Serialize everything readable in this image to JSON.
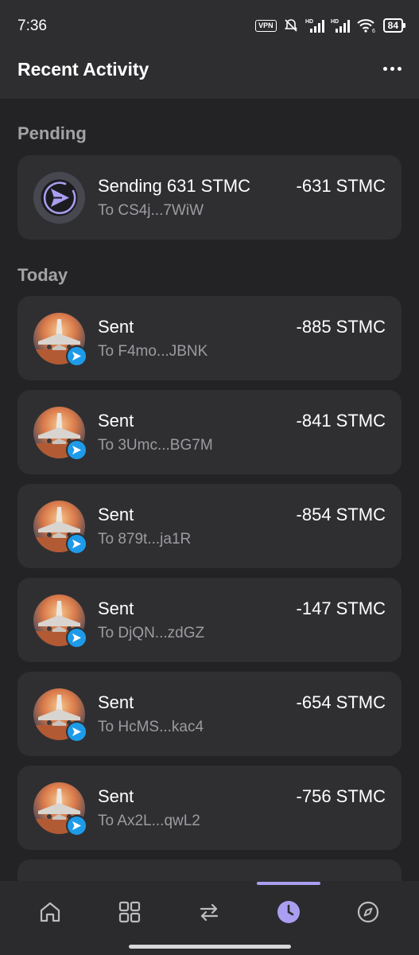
{
  "status": {
    "time": "7:36",
    "vpn": "VPN",
    "hd1": "HD",
    "hd2": "HD",
    "wifi_sub": "6",
    "battery": "84"
  },
  "header": {
    "title": "Recent Activity",
    "more_icon": "more-horizontal-icon"
  },
  "pending": {
    "label": "Pending",
    "items": [
      {
        "title": "Sending 631 STMC",
        "subtitle": "To CS4j...7WiW",
        "amount": "-631 STMC",
        "icon": "send-arrow-icon"
      }
    ]
  },
  "today": {
    "label": "Today",
    "items": [
      {
        "title": "Sent",
        "subtitle": "To F4mo...JBNK",
        "amount": "-885 STMC",
        "icon": "sent-badge-icon"
      },
      {
        "title": "Sent",
        "subtitle": "To 3Umc...BG7M",
        "amount": "-841 STMC",
        "icon": "sent-badge-icon"
      },
      {
        "title": "Sent",
        "subtitle": "To 879t...ja1R",
        "amount": "-854 STMC",
        "icon": "sent-badge-icon"
      },
      {
        "title": "Sent",
        "subtitle": "To DjQN...zdGZ",
        "amount": "-147 STMC",
        "icon": "sent-badge-icon"
      },
      {
        "title": "Sent",
        "subtitle": "To HcMS...kac4",
        "amount": "-654 STMC",
        "icon": "sent-badge-icon"
      },
      {
        "title": "Sent",
        "subtitle": "To Ax2L...qwL2",
        "amount": "-756 STMC",
        "icon": "sent-badge-icon"
      }
    ]
  },
  "nav": {
    "items": [
      {
        "icon": "home-icon",
        "active": false
      },
      {
        "icon": "grid-icon",
        "active": false
      },
      {
        "icon": "swap-icon",
        "active": false
      },
      {
        "icon": "clock-icon",
        "active": true
      },
      {
        "icon": "compass-icon",
        "active": false
      }
    ],
    "active_color": "#a99ef0"
  },
  "colors": {
    "background": "#232325",
    "card": "#2f2f32",
    "accent": "#a99ef0",
    "sent_badge": "#1e9be8"
  }
}
